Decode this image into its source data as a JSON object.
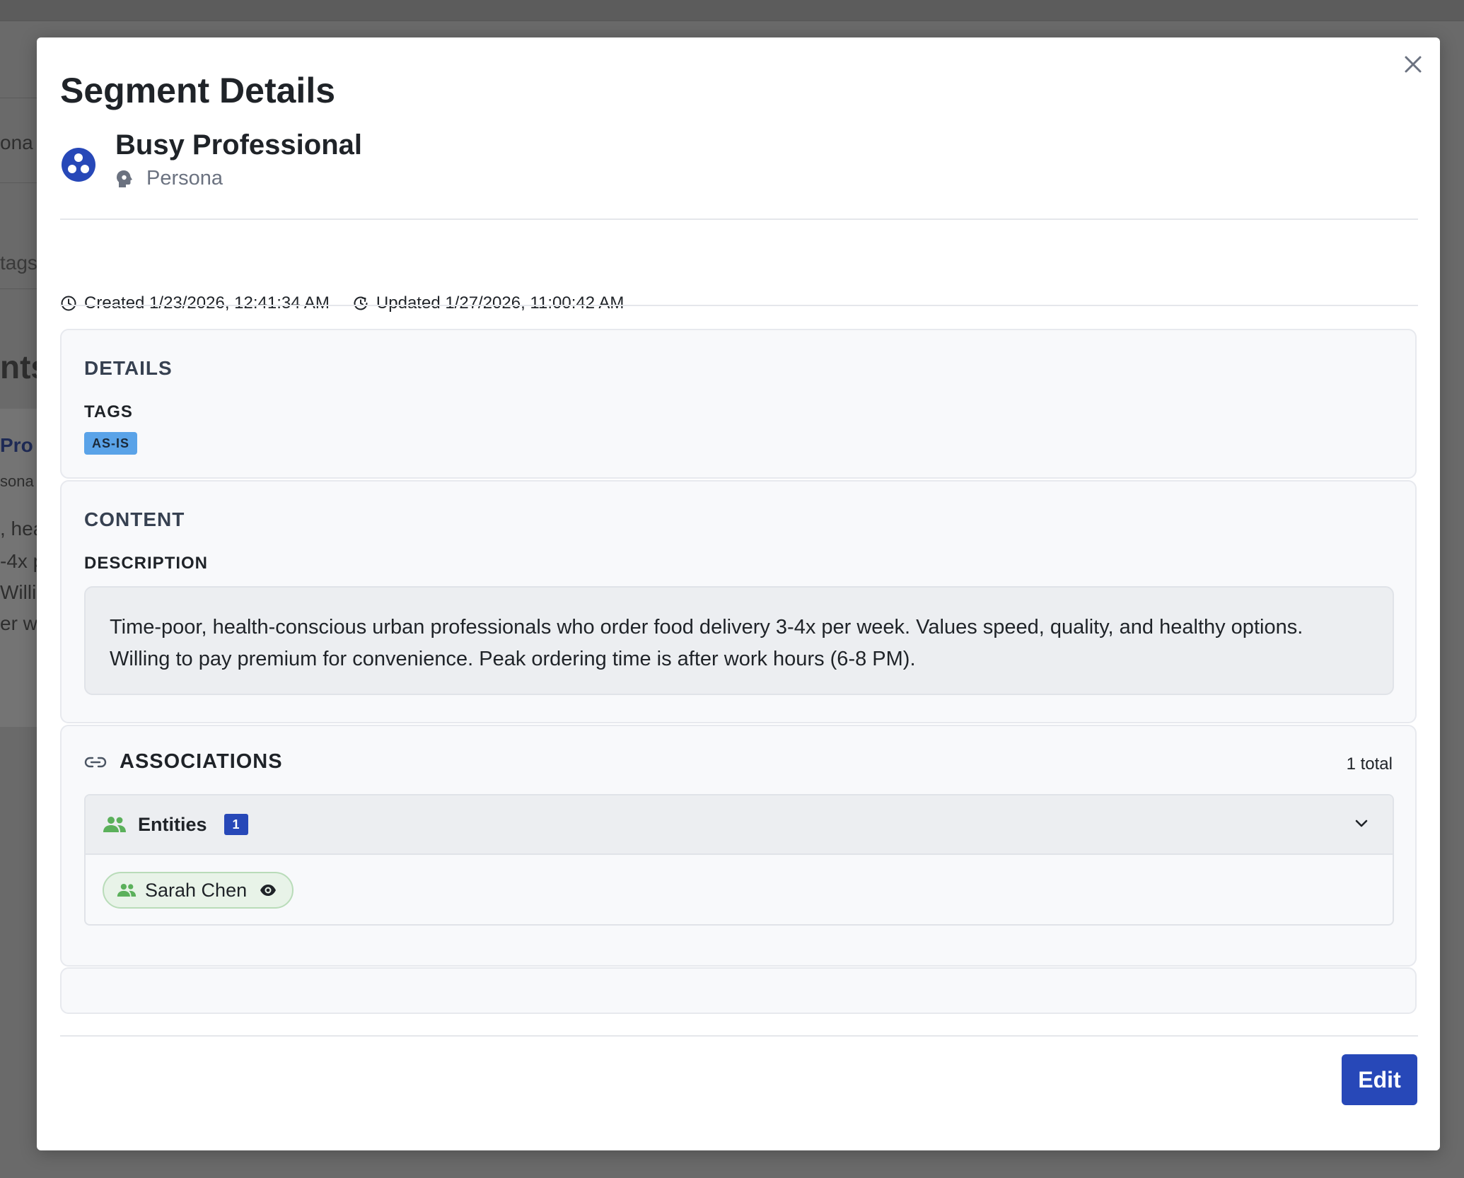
{
  "background": {
    "fragments": [
      "ona",
      "tags",
      "nts",
      "Pro",
      "sona",
      ", hea",
      "-4x p",
      "Willing",
      "er w..."
    ]
  },
  "modal": {
    "title": "Segment Details",
    "close_label": "×"
  },
  "segment": {
    "name": "Busy Professional",
    "type": "Persona",
    "created": "Created 1/23/2026, 12:41:34 AM",
    "updated": "Updated 1/27/2026, 11:00:42 AM"
  },
  "details": {
    "section_title": "DETAILS",
    "tags_label": "TAGS",
    "tags": [
      "AS-IS"
    ]
  },
  "content": {
    "section_title": "CONTENT",
    "description_label": "DESCRIPTION",
    "description": "Time-poor, health-conscious urban professionals who order food delivery 3-4x per week. Values speed, quality, and healthy options. Willing to pay premium for convenience. Peak ordering time is after work hours (6-8 PM)."
  },
  "associations": {
    "section_title": "ASSOCIATIONS",
    "total": "1 total",
    "groups": [
      {
        "name": "Entities",
        "count": "1",
        "items": [
          {
            "label": "Sarah Chen"
          }
        ]
      }
    ]
  },
  "footer": {
    "edit_label": "Edit"
  },
  "colors": {
    "primary": "#2748b8",
    "tag": "#5aa3e8",
    "entity_green": "#5bb05b",
    "overlay": "#6b6b6b"
  }
}
